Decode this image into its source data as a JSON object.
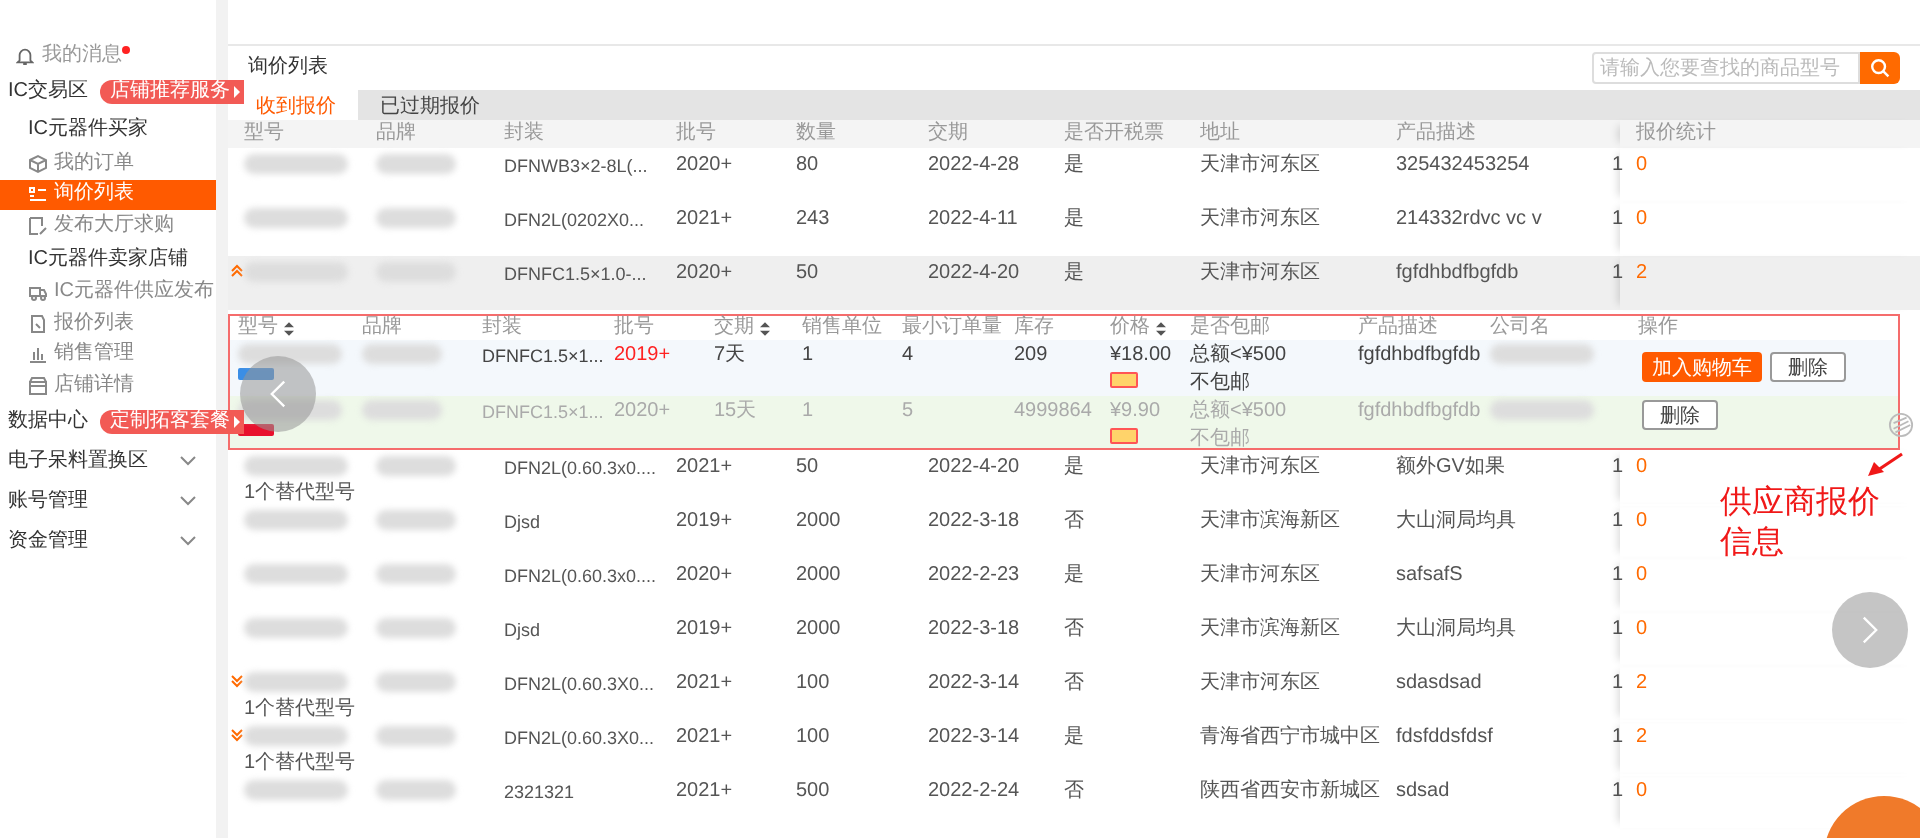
{
  "sidebar": {
    "items": [
      {
        "kind": "message",
        "label": "我的消息",
        "unread": true
      },
      {
        "kind": "section",
        "label": "IC交易区",
        "promo": "店铺推荐服务"
      },
      {
        "kind": "group",
        "label": "IC元器件买家"
      },
      {
        "kind": "link",
        "label": "我的订单",
        "selected": false
      },
      {
        "kind": "link",
        "label": "询价列表",
        "selected": true
      },
      {
        "kind": "link",
        "label": "发布大厅求购",
        "selected": false
      },
      {
        "kind": "group",
        "label": "IC元器件卖家店铺"
      },
      {
        "kind": "link",
        "label": "IC元器件供应发布",
        "selected": false
      },
      {
        "kind": "link",
        "label": "报价列表",
        "selected": false
      },
      {
        "kind": "link",
        "label": "销售管理",
        "selected": false
      },
      {
        "kind": "link",
        "label": "店铺详情",
        "selected": false
      },
      {
        "kind": "section",
        "label": "数据中心",
        "promo": "定制拓客套餐"
      },
      {
        "kind": "collapsible",
        "label": "电子呆料置换区",
        "expanded": false
      },
      {
        "kind": "collapsible",
        "label": "账号管理",
        "expanded": false
      },
      {
        "kind": "collapsible",
        "label": "资金管理",
        "expanded": false
      }
    ]
  },
  "main": {
    "title": "询价列表",
    "search": {
      "placeholder": "请输入您要查找的商品型号"
    },
    "tabs": [
      {
        "label": "收到报价",
        "selected": true
      },
      {
        "label": "已过期报价",
        "selected": false
      }
    ],
    "table": {
      "columns": [
        "型号",
        "品牌",
        "封装",
        "批号",
        "数量",
        "交期",
        "是否开税票",
        "地址",
        "产品描述",
        "报价统计"
      ],
      "rows": [
        {
          "expandable": false,
          "expanded": false,
          "package": "DFNWB3×2-8L(...",
          "batch": "2020+",
          "quantity": "80",
          "lead_time": "2022-4-28",
          "invoice": "是",
          "address": "天津市河东区",
          "description": "325432453254",
          "column_10": "1",
          "quote_count": "0"
        },
        {
          "expandable": false,
          "expanded": false,
          "package": "DFN2L(0202X0...",
          "batch": "2021+",
          "quantity": "243",
          "lead_time": "2022-4-11",
          "invoice": "是",
          "address": "天津市河东区",
          "description": "214332rdvc vc v",
          "column_10": "1",
          "quote_count": "0"
        },
        {
          "expandable": true,
          "expanded": true,
          "package": "DFNFC1.5×1.0-...",
          "batch": "2020+",
          "quantity": "50",
          "lead_time": "2022-4-20",
          "invoice": "是",
          "address": "天津市河东区",
          "description": "fgfdhbdfbgfdb",
          "column_10": "1",
          "quote_count": "2",
          "quotes": {
            "columns": [
              {
                "label": "型号",
                "sortable": true
              },
              {
                "label": "品牌",
                "sortable": false
              },
              {
                "label": "封装",
                "sortable": false
              },
              {
                "label": "批号",
                "sortable": false
              },
              {
                "label": "交期",
                "sortable": true
              },
              {
                "label": "销售单位",
                "sortable": false
              },
              {
                "label": "最小订单量",
                "sortable": false
              },
              {
                "label": "库存",
                "sortable": false
              },
              {
                "label": "价格",
                "sortable": true
              },
              {
                "label": "是否包邮",
                "sortable": false
              },
              {
                "label": "产品描述",
                "sortable": false
              },
              {
                "label": "公司名",
                "sortable": false
              },
              {
                "label": "操作",
                "sortable": false
              }
            ],
            "rows": [
              {
                "color": "#3a8ee6",
                "disabled": false,
                "package": "DFNFC1.5×1...",
                "batch": "2019+",
                "lead_time": "7天",
                "unit": "1",
                "min_order": "4",
                "stock": "209",
                "price": "¥18.00",
                "shipping_rule": "总额<¥500",
                "shipping": "不包邮",
                "description": "fgfdhbdfbgfdb",
                "buttons": [
                  {
                    "label": "加入购物车",
                    "kind": "primary"
                  },
                  {
                    "label": "删除",
                    "kind": "default"
                  }
                ]
              },
              {
                "color": "#e8112d",
                "disabled": true,
                "package": "DFNFC1.5×1...",
                "batch": "2020+",
                "lead_time": "15天",
                "unit": "1",
                "min_order": "5",
                "stock": "4999864",
                "price": "¥9.90",
                "shipping_rule": "总额<¥500",
                "shipping": "不包邮",
                "description": "fgfdhbdfbgfdb",
                "buttons": [
                  {
                    "label": "删除",
                    "kind": "default"
                  }
                ]
              }
            ]
          }
        },
        {
          "expandable": false,
          "expanded": false,
          "alternates": "1个替代型号",
          "package": "DFN2L(0.60.3x0....",
          "batch": "2021+",
          "quantity": "50",
          "lead_time": "2022-4-20",
          "invoice": "是",
          "address": "天津市河东区",
          "description": "额外GV如果",
          "column_10": "1",
          "quote_count": "0"
        },
        {
          "expandable": false,
          "expanded": false,
          "package": "Djsd",
          "batch": "2019+",
          "quantity": "2000",
          "lead_time": "2022-3-18",
          "invoice": "否",
          "address": "天津市滨海新区",
          "description": "大山洞局均具",
          "column_10": "1",
          "quote_count": "0"
        },
        {
          "expandable": false,
          "expanded": false,
          "package": "DFN2L(0.60.3x0....",
          "batch": "2020+",
          "quantity": "2000",
          "lead_time": "2022-2-23",
          "invoice": "是",
          "address": "天津市河东区",
          "description": "safsafS",
          "column_10": "1",
          "quote_count": "0"
        },
        {
          "expandable": false,
          "expanded": false,
          "package": "Djsd",
          "batch": "2019+",
          "quantity": "2000",
          "lead_time": "2022-3-18",
          "invoice": "否",
          "address": "天津市滨海新区",
          "description": "大山洞局均具",
          "column_10": "1",
          "quote_count": "0"
        },
        {
          "expandable": true,
          "expanded": false,
          "alternates": "1个替代型号",
          "package": "DFN2L(0.60.3X0...",
          "batch": "2021+",
          "quantity": "100",
          "lead_time": "2022-3-14",
          "invoice": "否",
          "address": "天津市河东区",
          "description": "sdasdsad",
          "column_10": "1",
          "quote_count": "2"
        },
        {
          "expandable": true,
          "expanded": false,
          "alternates": "1个替代型号",
          "package": "DFN2L(0.60.3X0...",
          "batch": "2021+",
          "quantity": "100",
          "lead_time": "2022-3-14",
          "invoice": "是",
          "address": "青海省西宁市城中区",
          "description": "fdsfddsfdsf",
          "column_10": "1",
          "quote_count": "2"
        },
        {
          "expandable": false,
          "expanded": false,
          "package": "2321321",
          "batch": "2021+",
          "quantity": "500",
          "lead_time": "2022-2-24",
          "invoice": "否",
          "address": "陕西省西安市新城区",
          "description": "sdsad",
          "column_10": "1",
          "quote_count": "0"
        }
      ]
    }
  },
  "annotation": {
    "text": "供应商报价信息"
  }
}
